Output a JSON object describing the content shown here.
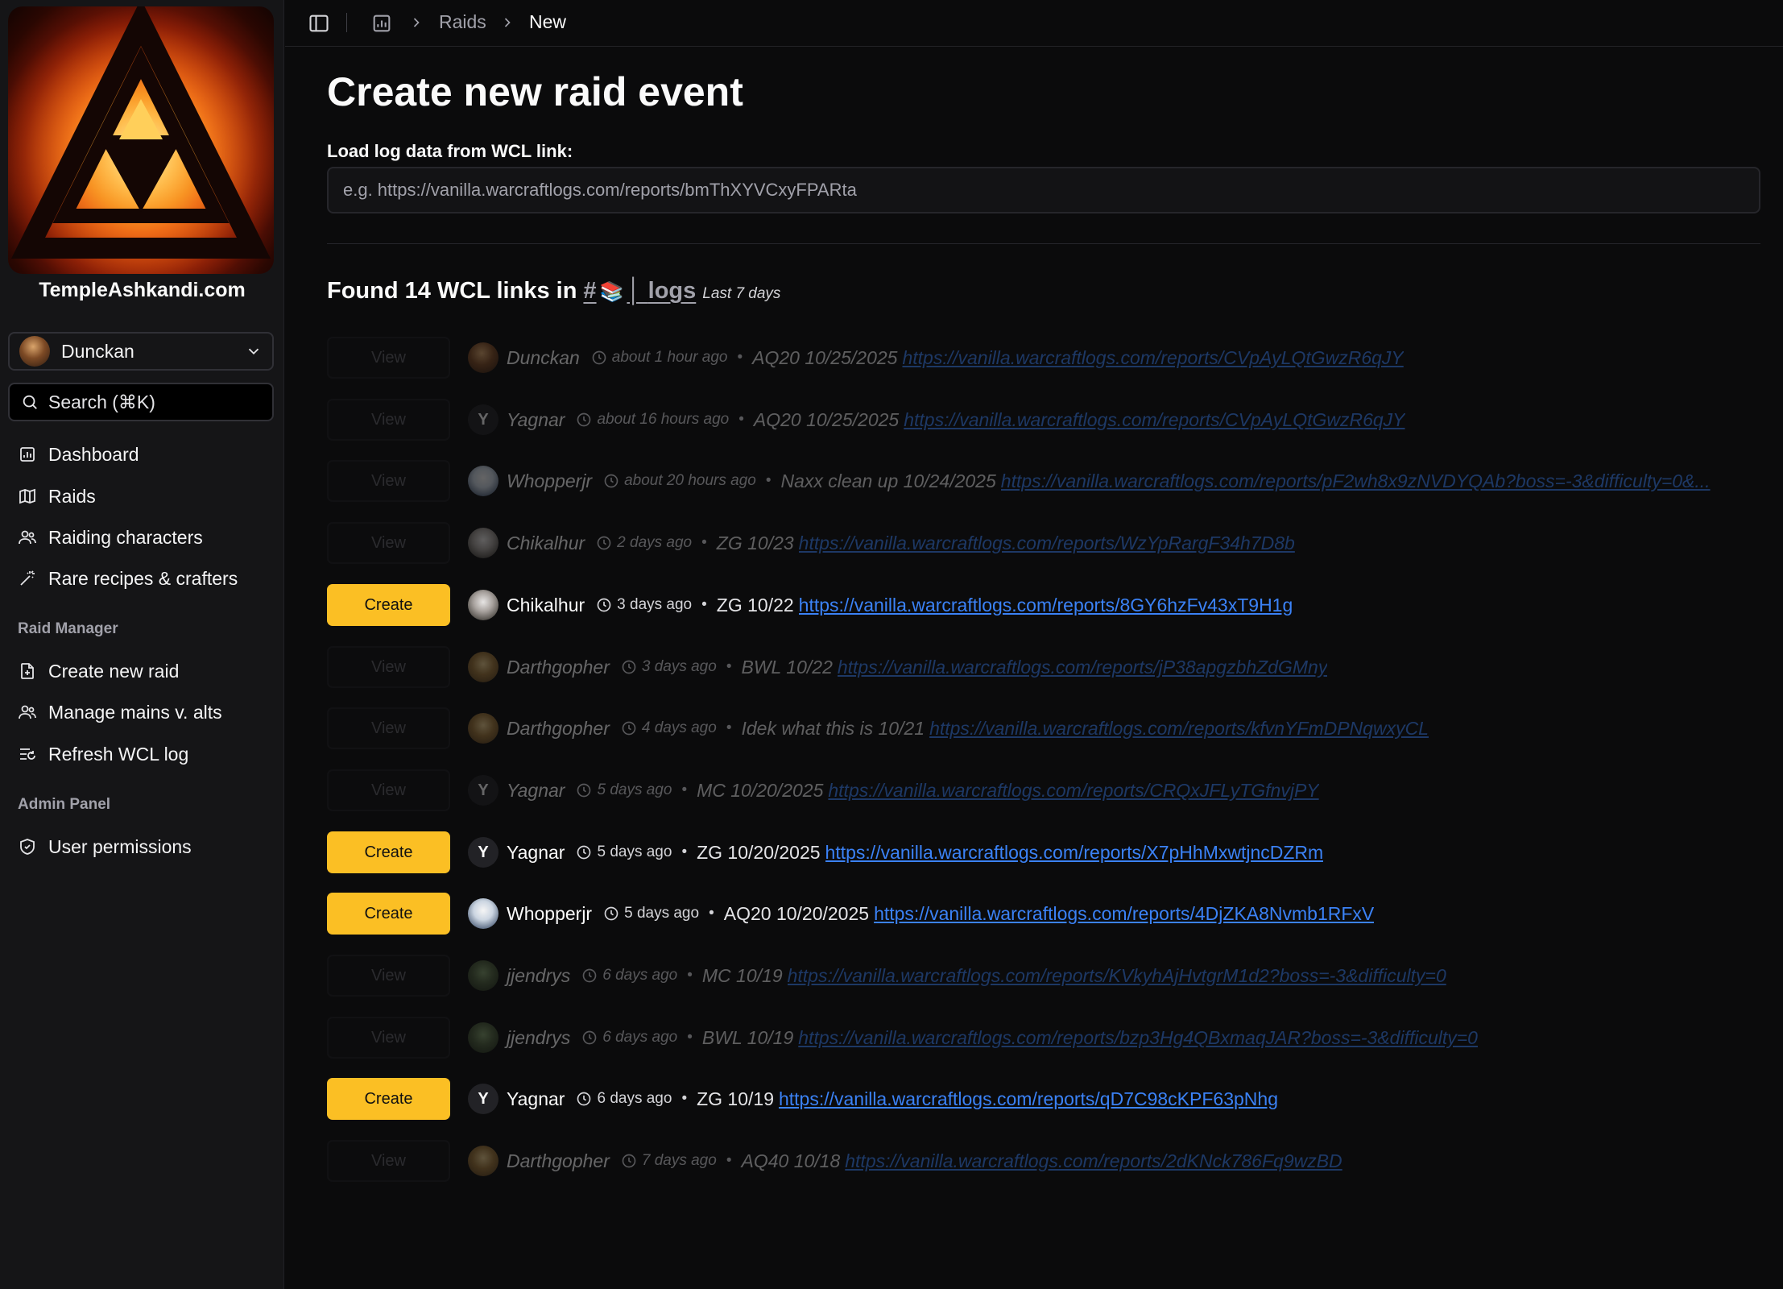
{
  "sidebar": {
    "site_name": "TempleAshkandi.com",
    "user": "Dunckan",
    "search_placeholder": "Search (⌘K)",
    "nav": [
      {
        "label": "Dashboard",
        "icon": "dashboard-icon"
      },
      {
        "label": "Raids",
        "icon": "map-icon"
      },
      {
        "label": "Raiding characters",
        "icon": "users-icon"
      },
      {
        "label": "Rare recipes & crafters",
        "icon": "wand-icon"
      }
    ],
    "raid_manager_heading": "Raid Manager",
    "raid_manager": [
      {
        "label": "Create new raid",
        "icon": "file-plus-icon"
      },
      {
        "label": "Manage mains v. alts",
        "icon": "users-icon"
      },
      {
        "label": "Refresh WCL log",
        "icon": "list-refresh-icon"
      }
    ],
    "admin_heading": "Admin Panel",
    "admin": [
      {
        "label": "User permissions",
        "icon": "shield-check-icon"
      }
    ]
  },
  "topbar": {
    "crumbs": [
      "Raids",
      "New"
    ]
  },
  "main": {
    "title": "Create new raid event",
    "field_label": "Load log data from WCL link:",
    "field_placeholder": "e.g. https://vanilla.warcraftlogs.com/reports/bmThXYVCxyFPARta",
    "found_prefix": "Found 14 WCL links in",
    "channel_hash": "#",
    "channel_name": "logs",
    "channel_range": "Last 7 days"
  },
  "colors": {
    "accent": "#fbbf24",
    "link": "#3b82f6",
    "background": "#0b0b0c",
    "sidebar": "#151517"
  },
  "rows": [
    {
      "action": "View",
      "created": true,
      "avatar": "img1",
      "poster": "Dunckan",
      "ago": "about 1 hour ago",
      "desc": "AQ20 10/25/2025",
      "link": "https://vanilla.warcraftlogs.com/reports/CVpAyLQtGwzR6qJY"
    },
    {
      "action": "View",
      "created": true,
      "avatar": "letter",
      "initial": "Y",
      "poster": "Yagnar",
      "ago": "about 16 hours ago",
      "desc": "AQ20 10/25/2025",
      "link": "https://vanilla.warcraftlogs.com/reports/CVpAyLQtGwzR6qJY"
    },
    {
      "action": "View",
      "created": true,
      "avatar": "img2",
      "poster": "Whopperjr",
      "ago": "about 20 hours ago",
      "desc": "Naxx clean up 10/24/2025",
      "link": "https://vanilla.warcraftlogs.com/reports/pF2wh8x9zNVDYQAb?boss=-3&difficulty=0&..."
    },
    {
      "action": "View",
      "created": true,
      "avatar": "img3",
      "poster": "Chikalhur",
      "ago": "2 days ago",
      "desc": "ZG 10/23",
      "link": "https://vanilla.warcraftlogs.com/reports/WzYpRargF34h7D8b"
    },
    {
      "action": "Create",
      "created": false,
      "avatar": "img3",
      "poster": "Chikalhur",
      "ago": "3 days ago",
      "desc": "ZG 10/22",
      "link": "https://vanilla.warcraftlogs.com/reports/8GY6hzFv43xT9H1g"
    },
    {
      "action": "View",
      "created": true,
      "avatar": "img4",
      "poster": "Darthgopher",
      "ago": "3 days ago",
      "desc": "BWL 10/22",
      "link": "https://vanilla.warcraftlogs.com/reports/jP38apgzbhZdGMny"
    },
    {
      "action": "View",
      "created": true,
      "avatar": "img4",
      "poster": "Darthgopher",
      "ago": "4 days ago",
      "desc": "Idek what this is 10/21",
      "link": "https://vanilla.warcraftlogs.com/reports/kfvnYFmDPNqwxyCL"
    },
    {
      "action": "View",
      "created": true,
      "avatar": "letter",
      "initial": "Y",
      "poster": "Yagnar",
      "ago": "5 days ago",
      "desc": "MC 10/20/2025",
      "link": "https://vanilla.warcraftlogs.com/reports/CRQxJFLyTGfnvjPY"
    },
    {
      "action": "Create",
      "created": false,
      "avatar": "letter",
      "initial": "Y",
      "poster": "Yagnar",
      "ago": "5 days ago",
      "desc": "ZG 10/20/2025",
      "link": "https://vanilla.warcraftlogs.com/reports/X7pHhMxwtjncDZRm"
    },
    {
      "action": "Create",
      "created": false,
      "avatar": "img2",
      "poster": "Whopperjr",
      "ago": "5 days ago",
      "desc": "AQ20 10/20/2025",
      "link": "https://vanilla.warcraftlogs.com/reports/4DjZKA8Nvmb1RFxV"
    },
    {
      "action": "View",
      "created": true,
      "avatar": "img5",
      "poster": "jjendrys",
      "ago": "6 days ago",
      "desc": "MC 10/19",
      "link": "https://vanilla.warcraftlogs.com/reports/KVkyhAjHvtgrM1d2?boss=-3&difficulty=0"
    },
    {
      "action": "View",
      "created": true,
      "avatar": "img5",
      "poster": "jjendrys",
      "ago": "6 days ago",
      "desc": "BWL 10/19",
      "link": "https://vanilla.warcraftlogs.com/reports/bzp3Hg4QBxmaqJAR?boss=-3&difficulty=0"
    },
    {
      "action": "Create",
      "created": false,
      "avatar": "letter",
      "initial": "Y",
      "poster": "Yagnar",
      "ago": "6 days ago",
      "desc": "ZG 10/19",
      "link": "https://vanilla.warcraftlogs.com/reports/qD7C98cKPF63pNhg"
    },
    {
      "action": "View",
      "created": true,
      "avatar": "img4",
      "poster": "Darthgopher",
      "ago": "7 days ago",
      "desc": "AQ40 10/18",
      "link": "https://vanilla.warcraftlogs.com/reports/2dKNck786Fq9wzBD"
    }
  ]
}
